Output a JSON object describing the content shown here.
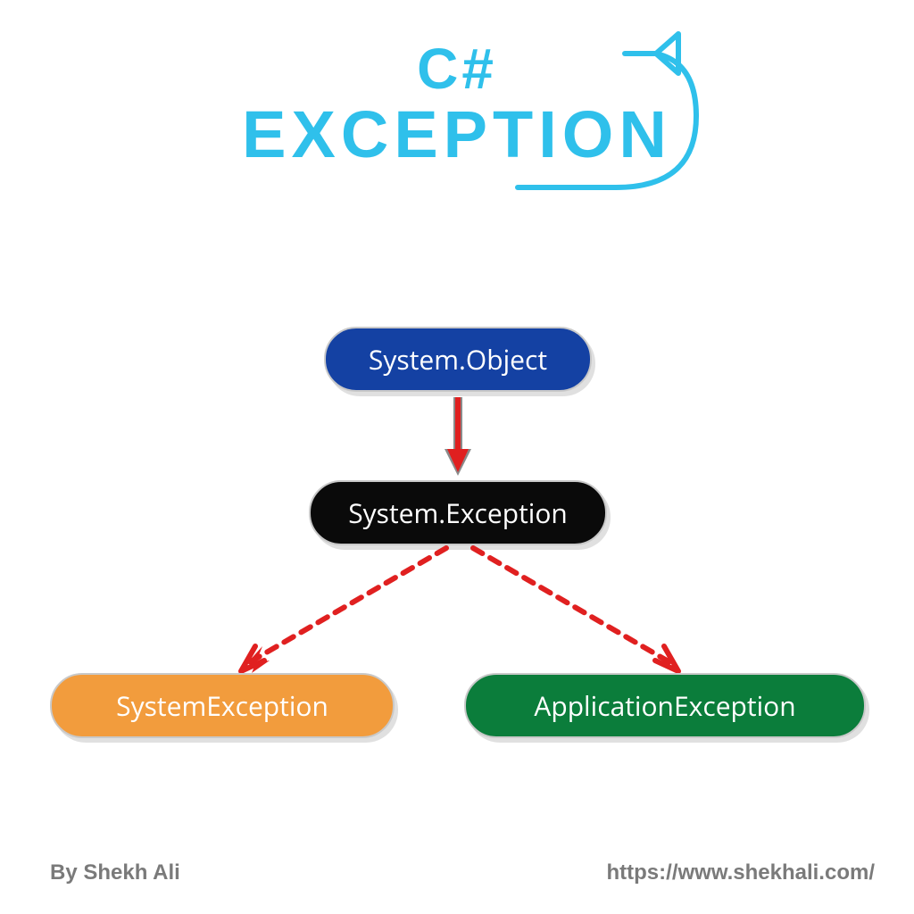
{
  "heading": {
    "line1": "C#",
    "line2": "EXCEPTION"
  },
  "nodes": {
    "object": "System.Object",
    "exception": "System.Exception",
    "systemException": "SystemException",
    "applicationException": "ApplicationException"
  },
  "footer": {
    "author": "By Shekh Ali",
    "url": "https://www.shekhali.com/"
  },
  "colors": {
    "accent": "#2fc0eb",
    "nodeObject": "#1441a3",
    "nodeException": "#0a0a0a",
    "nodeSystemExc": "#f29c3d",
    "nodeAppExc": "#0b7d3b",
    "arrowRed": "#e02020",
    "footerGray": "#7a7a7a"
  }
}
